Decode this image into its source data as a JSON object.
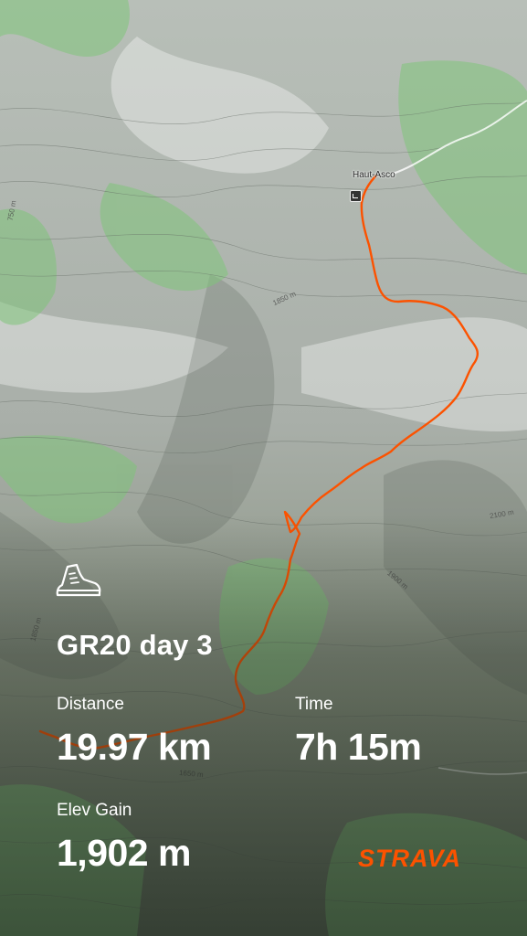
{
  "map": {
    "place_label": "Haut-Asco",
    "contour_labels": [
      "750 m",
      "1850 m",
      "2100 m",
      "1900 m",
      "1850 m",
      "1650 m"
    ],
    "route_color": "#fc5200"
  },
  "activity": {
    "icon": "hiking-boot-icon",
    "title": "GR20 day 3"
  },
  "stats": {
    "distance_label": "Distance",
    "distance_value": "19.97 km",
    "time_label": "Time",
    "time_value": "7h 15m",
    "elev_label": "Elev Gain",
    "elev_value": "1,902 m"
  },
  "brand": {
    "logo_text": "STRAVA",
    "color": "#fc5200"
  }
}
